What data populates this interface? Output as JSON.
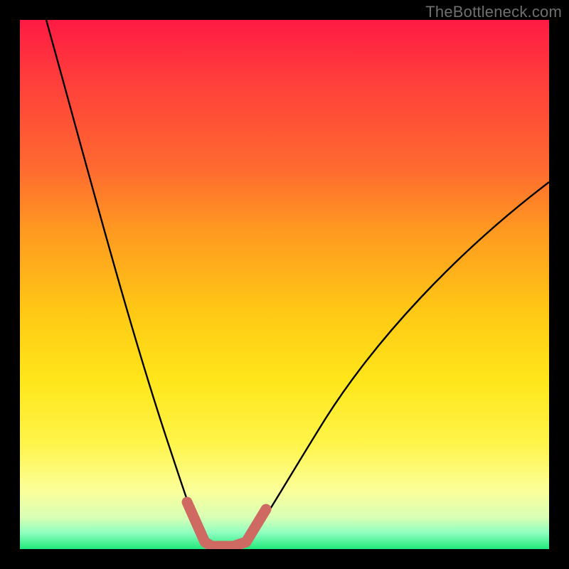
{
  "watermark": {
    "text": "TheBottleneck.com"
  },
  "colors": {
    "page_bg": "#000000",
    "curve_stroke": "#000000",
    "highlight_stroke": "#cf6a63"
  },
  "chart_data": {
    "type": "line",
    "title": "",
    "xlabel": "",
    "ylabel": "",
    "xlim": [
      0,
      100
    ],
    "ylim": [
      0,
      100
    ],
    "grid": false,
    "legend": "none",
    "series": [
      {
        "name": "bottleneck-curve",
        "x": [
          5,
          10,
          15,
          20,
          25,
          28,
          30,
          32,
          34,
          36,
          38,
          40,
          42,
          44,
          50,
          60,
          70,
          80,
          90,
          100
        ],
        "values": [
          100,
          82,
          64,
          46,
          28,
          16,
          10,
          5,
          2,
          1,
          1,
          2,
          5,
          10,
          18,
          30,
          40,
          48,
          55,
          61
        ]
      }
    ],
    "annotations": [
      {
        "name": "optimal-range-marker",
        "kind": "highlight-segment",
        "x_start": 30,
        "x_end": 44,
        "color": "#cf6a63"
      }
    ],
    "gradient_background": {
      "axis": "y",
      "stops": [
        {
          "pos": 0,
          "color": "#ff1a44"
        },
        {
          "pos": 40,
          "color": "#ff9a20"
        },
        {
          "pos": 70,
          "color": "#ffe61a"
        },
        {
          "pos": 92,
          "color": "#fbff9a"
        },
        {
          "pos": 100,
          "color": "#22e77a"
        }
      ]
    }
  }
}
